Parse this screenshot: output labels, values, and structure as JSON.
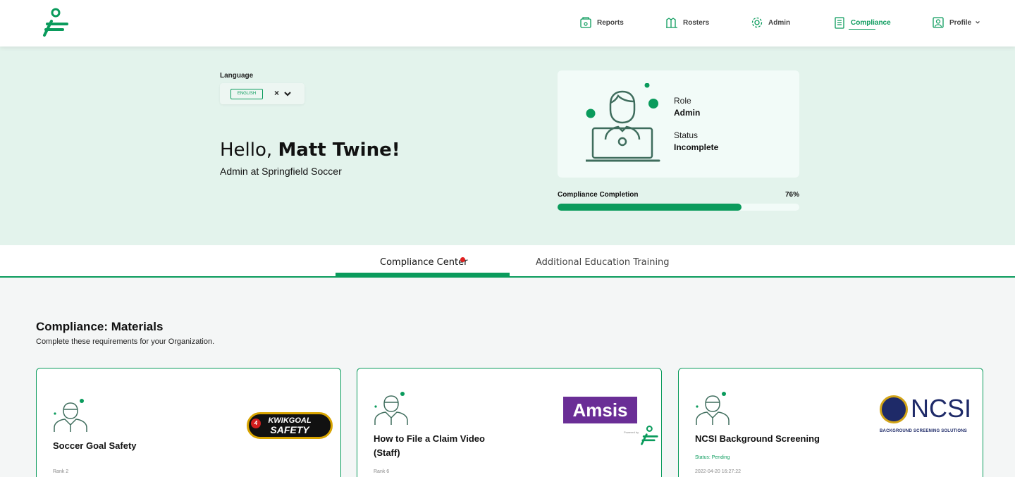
{
  "nav": {
    "items": [
      {
        "label": "Reports",
        "icon": "reports-icon"
      },
      {
        "label": "Rosters",
        "icon": "rosters-icon"
      },
      {
        "label": "Admin",
        "icon": "gear-icon"
      },
      {
        "label": "Compliance",
        "icon": "clipboard-icon",
        "active": true
      },
      {
        "label": "Profile",
        "icon": "profile-icon"
      }
    ]
  },
  "language": {
    "label": "Language",
    "selected": "ENGLISH",
    "clear": "×"
  },
  "greeting": {
    "hello": "Hello, ",
    "name": "Matt Twine!",
    "subtitle": "Admin at Springfield Soccer"
  },
  "role_card": {
    "role_label": "Role",
    "role_value": "Admin",
    "status_label": "Status",
    "status_value": "Incomplete"
  },
  "progress": {
    "label": "Compliance Completion",
    "percent_text": "76%",
    "value": 0.76
  },
  "tabs": [
    {
      "label": "Compliance Center",
      "active": true,
      "has_notification": true
    },
    {
      "label": "Additional Education Training",
      "active": false
    }
  ],
  "materials": {
    "title": "Compliance: Materials",
    "subtitle": "Complete these requirements for your Organization.",
    "cards": [
      {
        "title_lines": [
          "Soccer Goal Safety"
        ],
        "rank": "Rank 2",
        "brand": {
          "line1": "KWIKGOAL",
          "line2": "SAFETY",
          "badge": "4"
        }
      },
      {
        "title_lines": [
          "How to File a Claim Video",
          "(Staff)"
        ],
        "rank": "Rank 6",
        "brand": {
          "name": "Amsis",
          "powered": "Powered by"
        }
      },
      {
        "title_lines": [
          "NCSI Background Screening"
        ],
        "status": "Status: Pending",
        "date": "2022-04-20 16:27:22",
        "brand": {
          "name": "NCSI",
          "tagline": "BACKGROUND SCREENING SOLUTIONS"
        }
      }
    ]
  },
  "colors": {
    "accent": "#0a9b5c",
    "hero_bg": "#e3f3ec",
    "notification": "#e02020"
  }
}
